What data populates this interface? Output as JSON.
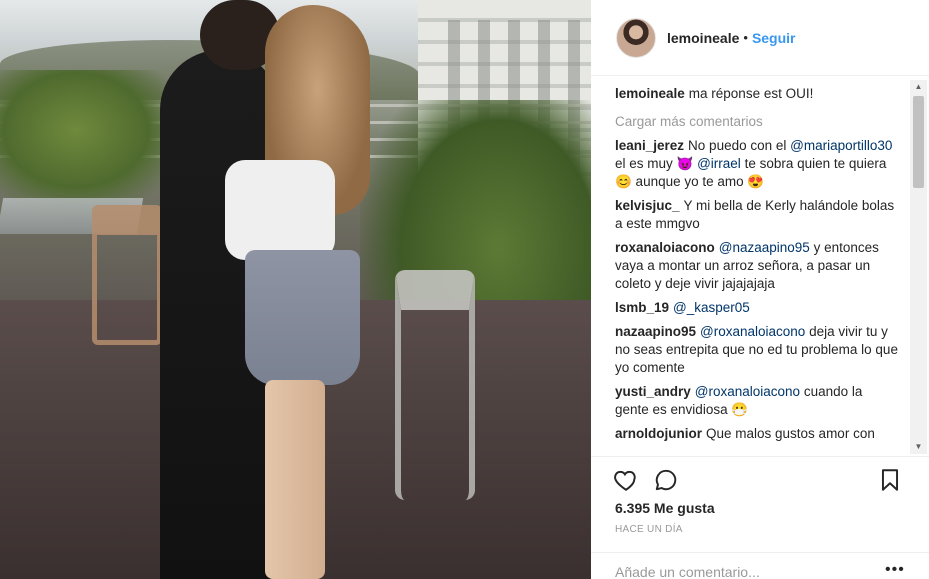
{
  "post": {
    "username": "lemoineale",
    "follow_label": "Seguir",
    "caption_user": "lemoineale",
    "caption_text": "ma réponse est OUI!",
    "load_more": "Cargar más comentarios",
    "comments": [
      {
        "user": "leani_jerez",
        "parts": [
          {
            "t": "text",
            "v": "No puedo con el "
          },
          {
            "t": "mention",
            "v": "@mariaportillo30"
          },
          {
            "t": "text",
            "v": " el es muy 😈 "
          },
          {
            "t": "mention",
            "v": "@irrael"
          },
          {
            "t": "text",
            "v": " te sobra quien te quiera 😊 aunque yo te amo 😍"
          }
        ]
      },
      {
        "user": "kelvisjuc_",
        "parts": [
          {
            "t": "text",
            "v": "Y mi bella de Kerly halándole bolas a este mmgvo"
          }
        ]
      },
      {
        "user": "roxanaloiacono",
        "parts": [
          {
            "t": "mention",
            "v": "@nazaapino95"
          },
          {
            "t": "text",
            "v": " y entonces vaya a montar un arroz señora, a pasar un coleto y deje vivir jajajajaja"
          }
        ]
      },
      {
        "user": "lsmb_19",
        "parts": [
          {
            "t": "mention",
            "v": "@_kasper05"
          }
        ]
      },
      {
        "user": "nazaapino95",
        "parts": [
          {
            "t": "mention",
            "v": "@roxanaloiacono"
          },
          {
            "t": "text",
            "v": " deja vivir tu y no seas entrepita que no ed tu problema lo que yo comente"
          }
        ]
      },
      {
        "user": "yusti_andry",
        "parts": [
          {
            "t": "mention",
            "v": "@roxanaloiacono"
          },
          {
            "t": "text",
            "v": " cuando la gente es envidiosa 😷"
          }
        ]
      },
      {
        "user": "arnoldojunior",
        "parts": [
          {
            "t": "text",
            "v": "Que malos gustos amor con"
          }
        ]
      }
    ],
    "likes": "6.395 Me gusta",
    "time": "HACE UN DÍA",
    "add_comment_placeholder": "Añade un comentario...",
    "more_label": "•••"
  },
  "icons": {
    "like": "heart-icon",
    "comment": "comment-icon",
    "save": "bookmark-icon"
  },
  "colors": {
    "link": "#3897f0",
    "mention": "#003569",
    "muted": "#999999"
  }
}
